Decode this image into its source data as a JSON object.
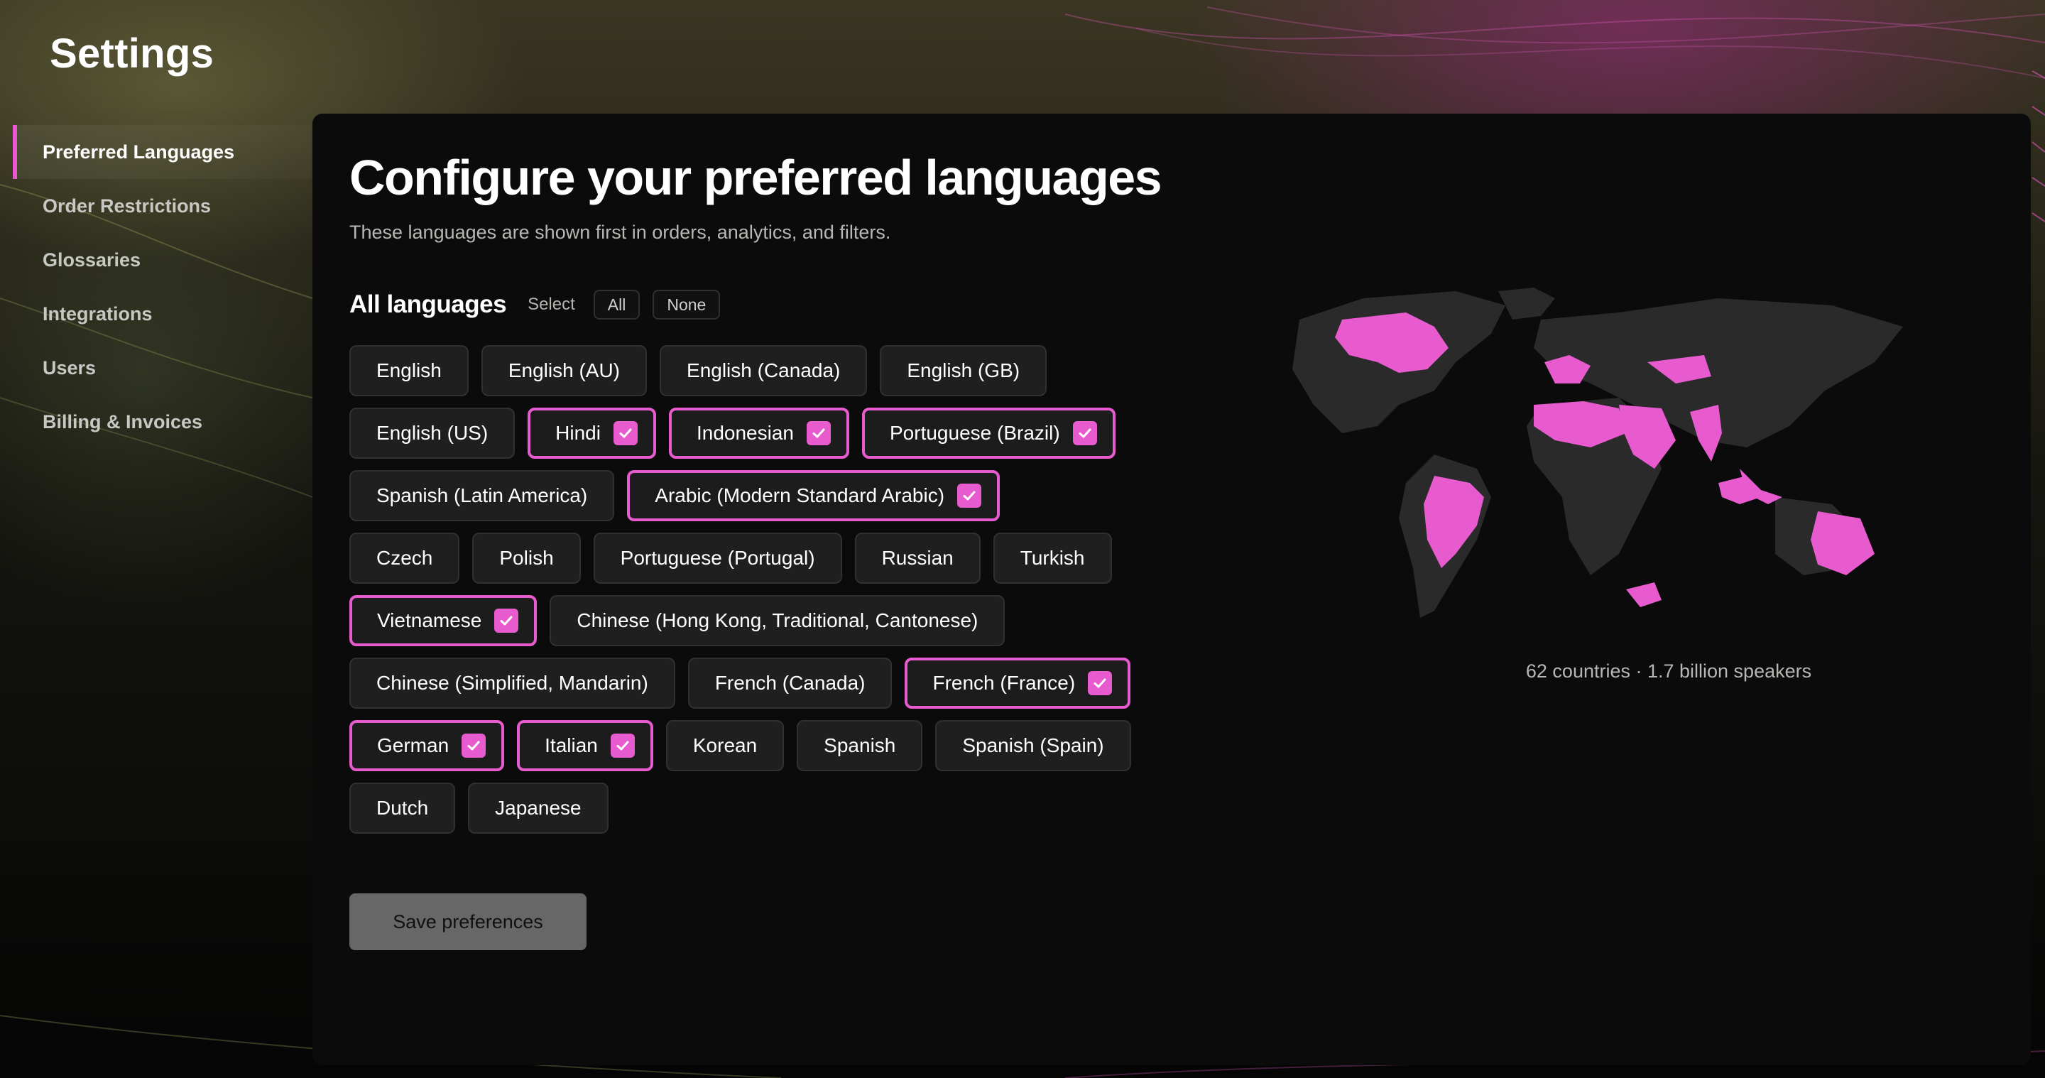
{
  "window": {
    "title": "Settings"
  },
  "sidebar": {
    "items": [
      {
        "label": "Preferred Languages",
        "active": true
      },
      {
        "label": "Order Restrictions",
        "active": false
      },
      {
        "label": "Glossaries",
        "active": false
      },
      {
        "label": "Integrations",
        "active": false
      },
      {
        "label": "Users",
        "active": false
      },
      {
        "label": "Billing & Invoices",
        "active": false
      }
    ]
  },
  "main": {
    "heading": "Configure your preferred languages",
    "subheading": "These languages are shown first in orders, analytics, and filters.",
    "languages_title": "All languages",
    "select_label": "Select",
    "select_all_label": "All",
    "select_none_label": "None",
    "languages": [
      [
        {
          "label": "English",
          "selected": false
        },
        {
          "label": "English (AU)",
          "selected": false
        },
        {
          "label": "English (Canada)",
          "selected": false
        },
        {
          "label": "English (GB)",
          "selected": false
        }
      ],
      [
        {
          "label": "English (US)",
          "selected": false
        },
        {
          "label": "Hindi",
          "selected": true
        },
        {
          "label": "Indonesian",
          "selected": true
        },
        {
          "label": "Portuguese (Brazil)",
          "selected": true
        }
      ],
      [
        {
          "label": "Spanish (Latin America)",
          "selected": false
        },
        {
          "label": "Arabic (Modern Standard Arabic)",
          "selected": true
        }
      ],
      [
        {
          "label": "Czech",
          "selected": false
        },
        {
          "label": "Polish",
          "selected": false
        },
        {
          "label": "Portuguese (Portugal)",
          "selected": false
        },
        {
          "label": "Russian",
          "selected": false
        },
        {
          "label": "Turkish",
          "selected": false
        }
      ],
      [
        {
          "label": "Vietnamese",
          "selected": true
        },
        {
          "label": "Chinese (Hong Kong, Traditional, Cantonese)",
          "selected": false
        }
      ],
      [
        {
          "label": "Chinese (Simplified, Mandarin)",
          "selected": false
        },
        {
          "label": "French (Canada)",
          "selected": false
        },
        {
          "label": "French (France)",
          "selected": true
        }
      ],
      [
        {
          "label": "German",
          "selected": true
        },
        {
          "label": "Italian",
          "selected": true
        },
        {
          "label": "Korean",
          "selected": false
        },
        {
          "label": "Spanish",
          "selected": false
        },
        {
          "label": "Spanish (Spain)",
          "selected": false
        }
      ],
      [
        {
          "label": "Dutch",
          "selected": false
        },
        {
          "label": "Japanese",
          "selected": false
        }
      ]
    ],
    "save_label": "Save preferences",
    "map_caption": "62 countries · 1.7 billion speakers"
  },
  "colors": {
    "accent": "#e85bcf",
    "panel_bg": "#0b0b0b",
    "chip_bg": "#1f1f1f",
    "map_land": "#2a2a2a",
    "save_bg": "#676767"
  },
  "icons": {
    "check": "check-icon"
  }
}
